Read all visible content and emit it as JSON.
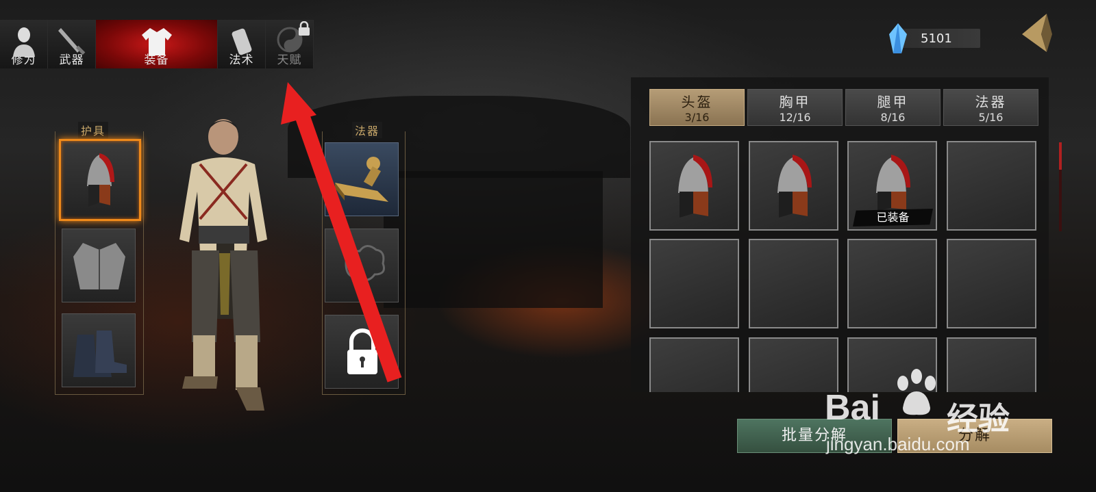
{
  "top_tabs": [
    {
      "label": "修为",
      "icon": "cultivation-figure-icon",
      "active": false,
      "locked": false
    },
    {
      "label": "武器",
      "icon": "sword-icon",
      "active": false,
      "locked": false
    },
    {
      "label": "装备",
      "icon": "robe-icon",
      "active": true,
      "locked": false
    },
    {
      "label": "法术",
      "icon": "scroll-icon",
      "active": false,
      "locked": false
    },
    {
      "label": "天赋",
      "icon": "yin-yang-icon",
      "active": false,
      "locked": true
    }
  ],
  "currency": {
    "icon": "blue-crystal-icon",
    "amount": "5101"
  },
  "left_panel": {
    "armor_title": "护具",
    "artifact_title": "法器",
    "armor_slots": [
      "helmet",
      "chest-armor",
      "boots"
    ],
    "artifact_slots": [
      "seal-artifact",
      "empty",
      "locked"
    ]
  },
  "inventory": {
    "categories": [
      {
        "name": "头盔",
        "count": "3/16",
        "active": true
      },
      {
        "name": "胸甲",
        "count": "12/16",
        "active": false
      },
      {
        "name": "腿甲",
        "count": "8/16",
        "active": false
      },
      {
        "name": "法器",
        "count": "5/16",
        "active": false
      }
    ],
    "equipped_label": "已装备",
    "grid": [
      {
        "item": "helmet",
        "equipped": false
      },
      {
        "item": "helmet",
        "equipped": false
      },
      {
        "item": "helmet",
        "equipped": true
      },
      {
        "item": "empty",
        "equipped": false
      }
    ]
  },
  "buttons": {
    "batch_decompose": "批量分解",
    "decompose": "分解"
  },
  "watermark": {
    "brand": "Bai",
    "cn": "经验",
    "url": "jingyan.baidu.com"
  },
  "colors": {
    "active_tab": "#b01010",
    "selected_slot": "#f08a1a",
    "annotation_arrow": "#e82020"
  }
}
